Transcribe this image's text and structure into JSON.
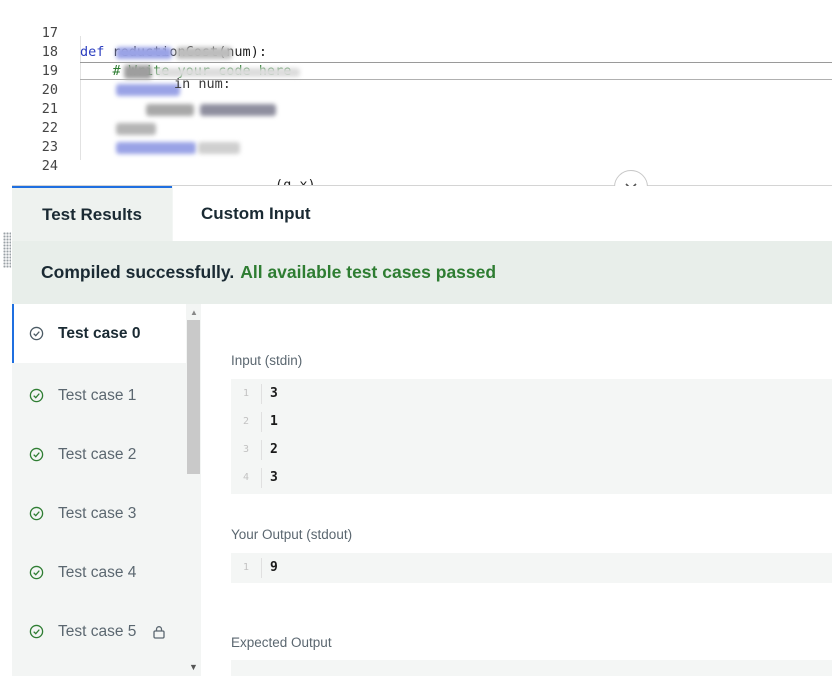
{
  "editor": {
    "lines": [
      {
        "num": "17",
        "keyword": "def",
        "text": " reductionCost(num):"
      },
      {
        "num": "18",
        "comment": "    # Write your code here"
      },
      {
        "num": "19"
      },
      {
        "num": "20"
      },
      {
        "num": "21",
        "text": "in num:"
      },
      {
        "num": "22",
        "text": "(q,x)"
      },
      {
        "num": "23"
      },
      {
        "num": "24"
      }
    ]
  },
  "tabs": [
    {
      "label": "Test Results",
      "active": true
    },
    {
      "label": "Custom Input",
      "active": false
    }
  ],
  "banner": {
    "compiled": "Compiled successfully.",
    "status": "All available test cases passed"
  },
  "test_cases": [
    {
      "label": "Test case 0",
      "passed": true,
      "locked": false,
      "active": true
    },
    {
      "label": "Test case 1",
      "passed": true,
      "locked": false,
      "active": false
    },
    {
      "label": "Test case 2",
      "passed": true,
      "locked": false,
      "active": false
    },
    {
      "label": "Test case 3",
      "passed": true,
      "locked": false,
      "active": false
    },
    {
      "label": "Test case 4",
      "passed": true,
      "locked": false,
      "active": false
    },
    {
      "label": "Test case 5",
      "passed": true,
      "locked": true,
      "active": false
    }
  ],
  "result": {
    "input_label": "Input (stdin)",
    "input_lines": [
      {
        "num": "1",
        "value": "3"
      },
      {
        "num": "2",
        "value": "1"
      },
      {
        "num": "3",
        "value": "2"
      },
      {
        "num": "4",
        "value": "3"
      }
    ],
    "output_label": "Your Output (stdout)",
    "output_lines": [
      {
        "num": "1",
        "value": "9"
      }
    ],
    "expected_label": "Expected Output"
  },
  "colors": {
    "accent": "#1f6fe0",
    "success": "#2e7d32",
    "keyword": "#2b3dbf",
    "comment": "#2e7d32"
  },
  "icons": {
    "collapse": "chevron-down-icon",
    "passed": "check-circle-icon",
    "locked": "lock-icon",
    "drag_handle": "grip-icon"
  }
}
